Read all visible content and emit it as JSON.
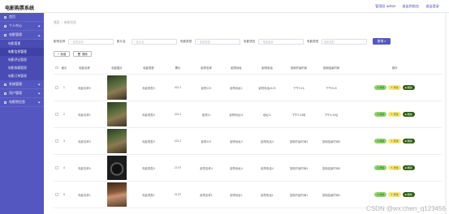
{
  "app": {
    "title": "电影购票系统",
    "top_links": [
      "管理员 admin",
      "退出到前台",
      "退出登录"
    ]
  },
  "sidebar": {
    "items": [
      {
        "label": "首页",
        "expand": false
      },
      {
        "label": "个人中心",
        "expand": true
      },
      {
        "label": "电影管理",
        "expand": true,
        "children": [
          {
            "label": "电影管理",
            "active": false
          },
          {
            "label": "电影信息管理",
            "active": true
          },
          {
            "label": "电影评论管理",
            "active": false
          },
          {
            "label": "电影收藏管理",
            "active": false
          },
          {
            "label": "电影订单管理",
            "active": false
          }
        ]
      },
      {
        "label": "系统管理",
        "expand": true
      },
      {
        "label": "用户管理",
        "expand": true
      },
      {
        "label": "电影院信息",
        "expand": true
      }
    ]
  },
  "breadcrumb": {
    "home": "首页",
    "separator": "/",
    "current": "电影信息"
  },
  "search": {
    "fields": [
      {
        "label": "影院名称",
        "placeholder": "影院名称"
      },
      {
        "label": "影片名",
        "placeholder": "影片名"
      },
      {
        "label": "电影类型",
        "placeholder": "电影类型"
      },
      {
        "label": "电影语言",
        "placeholder": "电影语言"
      },
      {
        "label": "电影类型",
        "placeholder": "电影类型"
      }
    ],
    "button": "查询"
  },
  "actions": {
    "add": "新增",
    "delete": "删除"
  },
  "table": {
    "headers": [
      "索引",
      "电影名称",
      "电影图片",
      "电影类型",
      "票价",
      "影院名称",
      "影院地址",
      "影院电话",
      "放映开始时间",
      "放映结束时间",
      "操作"
    ],
    "rows": [
      {
        "idx": "1",
        "name": "电影名称3",
        "type": "电影类型3",
        "price": "421.2",
        "cinema": "影院123",
        "addr": "影院地址1",
        "phone": "影院电话4123",
        "start": "下午3:15",
        "end": "下午5:15",
        "img": "forest"
      },
      {
        "idx": "2",
        "name": "电影名称1",
        "type": "电影类型4",
        "price": "421.2",
        "cinema": "影院11",
        "addr": "影院地址11",
        "phone": "地址11",
        "start": "下午2:34前",
        "end": "下午4:34后",
        "img": "forest"
      },
      {
        "idx": "3",
        "name": "电影名称3",
        "type": "电影类型3",
        "price": "421.2",
        "cinema": "影院123",
        "addr": "影院地址3",
        "phone": "影院电话3",
        "start": "放映开始时间3",
        "end": "放映结束时间3",
        "img": "forest"
      },
      {
        "idx": "4",
        "name": "电影名称4",
        "type": "电影类型4",
        "price": "21.57",
        "cinema": "影院名称4",
        "addr": "影院地址4",
        "phone": "影院电话4",
        "start": "放映开始时间4",
        "end": "放映结束时间4",
        "img": "camera"
      },
      {
        "idx": "5",
        "name": "电影名称1",
        "type": "电影类型1",
        "price": "31.87",
        "cinema": "影院名称1",
        "addr": "影院地址1",
        "phone": "影院电话1",
        "start": "放映开始时间1",
        "end": "放映结束时间1",
        "img": "portrait"
      }
    ],
    "ops": {
      "view": "详情",
      "edit": "修改",
      "del": "删除"
    }
  },
  "watermark": "CSDN @wx:chen_q123456",
  "colors": {
    "sidebar": "#5557c0",
    "primary": "#5557c0",
    "view": "#8bd36a",
    "edit": "#f5e777",
    "del": "#2e5f12"
  }
}
